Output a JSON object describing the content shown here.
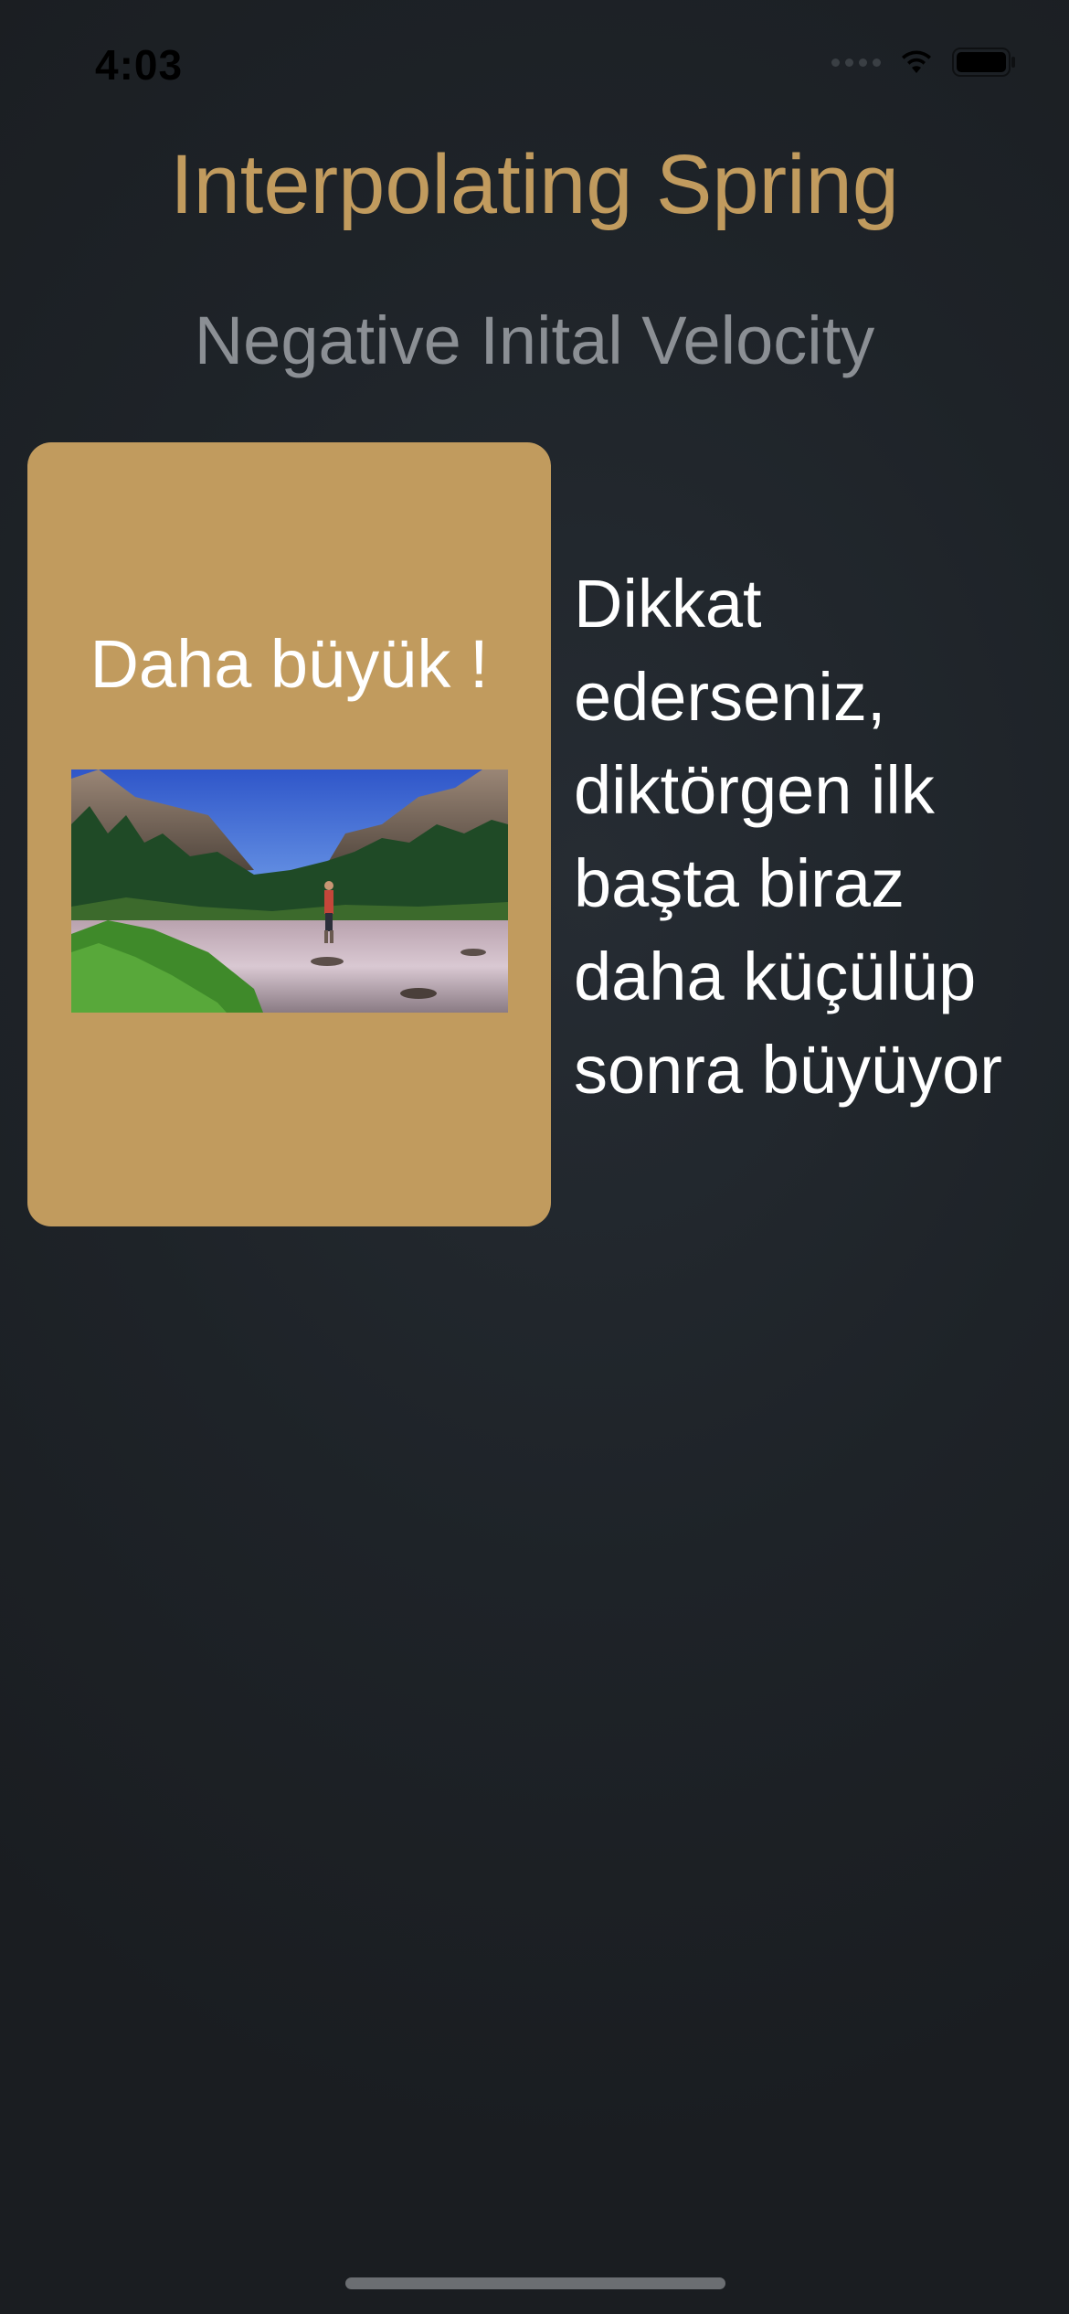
{
  "status_bar": {
    "time": "4:03",
    "icons": [
      "signal-dots-icon",
      "wifi-icon",
      "battery-icon"
    ]
  },
  "header": {
    "title": "Interpolating Spring",
    "subtitle": "Negative Inital Velocity"
  },
  "card": {
    "label": "Daha büyük !",
    "image_icon": "landscape-photo"
  },
  "side_note": "Dikkat\nederseniz,\ndiktörgen ilk\nbaşta biraz\ndaha küçülüp\nsonra büyüyor",
  "colors": {
    "accent": "#c19b5e",
    "subtitle": "#8b8f94",
    "background": "#1e2328",
    "text": "#ffffff"
  }
}
